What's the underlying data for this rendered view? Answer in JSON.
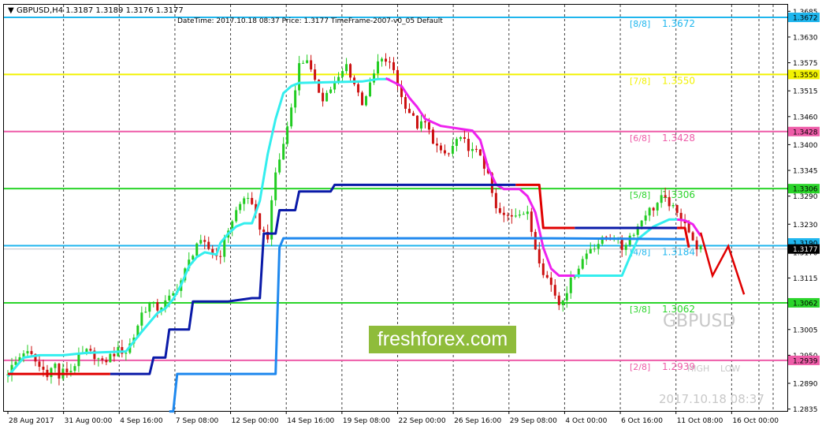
{
  "header": {
    "symbol_line": "GBPUSD,H4  1.3187 1.3189 1.3176 1.3177",
    "indicator_line": "DateTime: 2017.10.18 08:37    Price: 1.3177    TimeFrame-2007-v0_05    Default"
  },
  "watermark": {
    "brand": "freshforex.com",
    "symbol": "GBPUSD",
    "timestamp": "2017.10.18 08:37",
    "high_label": "HIGH",
    "low_label": "LOW"
  },
  "colors": {
    "bull": "#22cc22",
    "bear": "#cc1111",
    "cyan": "#33eeee",
    "magenta": "#ee22ee",
    "navy": "#0a1aa8",
    "blue": "#1e88ee",
    "red": "#e00000",
    "level_cyan": "#1fb6ee",
    "level_yellow": "#f2f200",
    "level_pink": "#ee5ca8",
    "level_green": "#2ad42a"
  },
  "chart_data": {
    "type": "candlestick",
    "title": "GBPUSD,H4",
    "ylim": [
      1.2831,
      1.3699
    ],
    "x_tick_labels": [
      "28 Aug 2017",
      "31 Aug 00:00",
      "4 Sep 16:00",
      "7 Sep 08:00",
      "12 Sep 00:00",
      "14 Sep 16:00",
      "19 Sep 08:00",
      "22 Sep 00:00",
      "26 Sep 16:00",
      "29 Sep 08:00",
      "4 Oct 00:00",
      "6 Oct 16:00",
      "11 Oct 08:00",
      "16 Oct 00:00"
    ],
    "y_tick_labels": [
      1.3685,
      1.363,
      1.3575,
      1.3515,
      1.346,
      1.34,
      1.3345,
      1.329,
      1.323,
      1.317,
      1.3115,
      1.306,
      1.3005,
      1.295,
      1.289,
      1.2835
    ],
    "current_price": 1.3177,
    "murrey_levels": [
      {
        "label": "[8/8]",
        "value": 1.3672,
        "tag": "1.3672",
        "color": "#1fb6ee"
      },
      {
        "label": "[7/8]",
        "value": 1.355,
        "tag": "1.3550",
        "color": "#f2f200"
      },
      {
        "label": "[6/8]",
        "value": 1.3428,
        "tag": "1.3428",
        "color": "#ee5ca8"
      },
      {
        "label": "[5/8]",
        "value": 1.3306,
        "tag": "1.3306",
        "color": "#2ad42a"
      },
      {
        "label": "[4/8]",
        "value": 1.3184,
        "tag": "1.3190",
        "color": "#1fb6ee"
      },
      {
        "label": "[3/8]",
        "value": 1.3062,
        "tag": "1.3062",
        "color": "#2ad42a"
      },
      {
        "label": "[2/8]",
        "value": 1.2939,
        "tag": "1.2939",
        "color": "#ee5ca8"
      }
    ],
    "close_series": [
      {
        "x": 0,
        "y": 1.2915
      },
      {
        "x": 2,
        "y": 1.2935
      },
      {
        "x": 4,
        "y": 1.2958
      },
      {
        "x": 6,
        "y": 1.2948
      },
      {
        "x": 8,
        "y": 1.2925
      },
      {
        "x": 10,
        "y": 1.2912
      },
      {
        "x": 12,
        "y": 1.293
      },
      {
        "x": 13,
        "y": 1.2902
      },
      {
        "x": 14,
        "y": 1.2915
      },
      {
        "x": 16,
        "y": 1.2918
      },
      {
        "x": 18,
        "y": 1.2945
      },
      {
        "x": 20,
        "y": 1.2957
      },
      {
        "x": 22,
        "y": 1.295
      },
      {
        "x": 24,
        "y": 1.2932
      },
      {
        "x": 26,
        "y": 1.2948
      },
      {
        "x": 28,
        "y": 1.296
      },
      {
        "x": 30,
        "y": 1.2958
      },
      {
        "x": 32,
        "y": 1.299
      },
      {
        "x": 34,
        "y": 1.304
      },
      {
        "x": 36,
        "y": 1.306
      },
      {
        "x": 38,
        "y": 1.305
      },
      {
        "x": 40,
        "y": 1.3062
      },
      {
        "x": 42,
        "y": 1.308
      },
      {
        "x": 44,
        "y": 1.311
      },
      {
        "x": 46,
        "y": 1.315
      },
      {
        "x": 48,
        "y": 1.319
      },
      {
        "x": 50,
        "y": 1.3185
      },
      {
        "x": 52,
        "y": 1.317
      },
      {
        "x": 53,
        "y": 1.3162
      },
      {
        "x": 54,
        "y": 1.3168
      },
      {
        "x": 56,
        "y": 1.322
      },
      {
        "x": 58,
        "y": 1.3258
      },
      {
        "x": 60,
        "y": 1.3285
      },
      {
        "x": 61,
        "y": 1.329
      },
      {
        "x": 62,
        "y": 1.3265
      },
      {
        "x": 64,
        "y": 1.3225
      },
      {
        "x": 65,
        "y": 1.321
      },
      {
        "x": 66,
        "y": 1.3205
      },
      {
        "x": 68,
        "y": 1.334
      },
      {
        "x": 70,
        "y": 1.34
      },
      {
        "x": 72,
        "y": 1.348
      },
      {
        "x": 74,
        "y": 1.357
      },
      {
        "x": 76,
        "y": 1.3585
      },
      {
        "x": 77,
        "y": 1.3555
      },
      {
        "x": 78,
        "y": 1.353
      },
      {
        "x": 80,
        "y": 1.35
      },
      {
        "x": 82,
        "y": 1.352
      },
      {
        "x": 84,
        "y": 1.354
      },
      {
        "x": 86,
        "y": 1.357
      },
      {
        "x": 88,
        "y": 1.353
      },
      {
        "x": 90,
        "y": 1.349
      },
      {
        "x": 92,
        "y": 1.3525
      },
      {
        "x": 94,
        "y": 1.3575
      },
      {
        "x": 96,
        "y": 1.358
      },
      {
        "x": 98,
        "y": 1.356
      },
      {
        "x": 100,
        "y": 1.35
      },
      {
        "x": 102,
        "y": 1.347
      },
      {
        "x": 104,
        "y": 1.344
      },
      {
        "x": 106,
        "y": 1.3445
      },
      {
        "x": 108,
        "y": 1.341
      },
      {
        "x": 110,
        "y": 1.338
      },
      {
        "x": 112,
        "y": 1.338
      },
      {
        "x": 114,
        "y": 1.341
      },
      {
        "x": 116,
        "y": 1.3405
      },
      {
        "x": 118,
        "y": 1.3385
      },
      {
        "x": 120,
        "y": 1.338
      },
      {
        "x": 122,
        "y": 1.333
      },
      {
        "x": 124,
        "y": 1.326
      },
      {
        "x": 126,
        "y": 1.3245
      },
      {
        "x": 128,
        "y": 1.325
      },
      {
        "x": 130,
        "y": 1.3258
      },
      {
        "x": 132,
        "y": 1.325
      },
      {
        "x": 134,
        "y": 1.318
      },
      {
        "x": 136,
        "y": 1.313
      },
      {
        "x": 138,
        "y": 1.31
      },
      {
        "x": 140,
        "y": 1.306
      },
      {
        "x": 142,
        "y": 1.309
      },
      {
        "x": 144,
        "y": 1.3125
      },
      {
        "x": 146,
        "y": 1.3155
      },
      {
        "x": 148,
        "y": 1.318
      },
      {
        "x": 150,
        "y": 1.319
      },
      {
        "x": 152,
        "y": 1.32
      },
      {
        "x": 154,
        "y": 1.3205
      },
      {
        "x": 156,
        "y": 1.3178
      },
      {
        "x": 158,
        "y": 1.3205
      },
      {
        "x": 160,
        "y": 1.3225
      },
      {
        "x": 162,
        "y": 1.3255
      },
      {
        "x": 164,
        "y": 1.3265
      },
      {
        "x": 166,
        "y": 1.3285
      },
      {
        "x": 168,
        "y": 1.3275
      },
      {
        "x": 170,
        "y": 1.325
      },
      {
        "x": 172,
        "y": 1.3238
      },
      {
        "x": 174,
        "y": 1.319
      },
      {
        "x": 176,
        "y": 1.3177
      }
    ],
    "indicator_lines": [
      {
        "color": "#33eeee",
        "points": [
          {
            "x": 0,
            "y": 1.2905
          },
          {
            "x": 4,
            "y": 1.2945
          },
          {
            "x": 8,
            "y": 1.295
          },
          {
            "x": 14,
            "y": 1.295
          },
          {
            "x": 20,
            "y": 1.2955
          },
          {
            "x": 30,
            "y": 1.2958
          },
          {
            "x": 34,
            "y": 1.3
          },
          {
            "x": 38,
            "y": 1.304
          },
          {
            "x": 40,
            "y": 1.305
          },
          {
            "x": 42,
            "y": 1.307
          },
          {
            "x": 44,
            "y": 1.31
          },
          {
            "x": 46,
            "y": 1.314
          },
          {
            "x": 48,
            "y": 1.316
          },
          {
            "x": 50,
            "y": 1.317
          },
          {
            "x": 53,
            "y": 1.3165
          },
          {
            "x": 54,
            "y": 1.319
          },
          {
            "x": 56,
            "y": 1.321
          },
          {
            "x": 58,
            "y": 1.3225
          },
          {
            "x": 60,
            "y": 1.3232
          },
          {
            "x": 62,
            "y": 1.3232
          },
          {
            "x": 64,
            "y": 1.328
          },
          {
            "x": 66,
            "y": 1.338
          },
          {
            "x": 68,
            "y": 1.3455
          },
          {
            "x": 70,
            "y": 1.351
          },
          {
            "x": 72,
            "y": 1.3525
          },
          {
            "x": 74,
            "y": 1.3532
          },
          {
            "x": 90,
            "y": 1.3535
          },
          {
            "x": 94,
            "y": 1.354
          },
          {
            "x": 97,
            "y": 1.354
          }
        ]
      },
      {
        "color": "#ee22ee",
        "points": [
          {
            "x": 96,
            "y": 1.3542
          },
          {
            "x": 100,
            "y": 1.3525
          },
          {
            "x": 102,
            "y": 1.35
          },
          {
            "x": 104,
            "y": 1.348
          },
          {
            "x": 106,
            "y": 1.3455
          },
          {
            "x": 110,
            "y": 1.344
          },
          {
            "x": 118,
            "y": 1.343
          },
          {
            "x": 120,
            "y": 1.341
          },
          {
            "x": 122,
            "y": 1.335
          },
          {
            "x": 124,
            "y": 1.3315
          },
          {
            "x": 126,
            "y": 1.3305
          },
          {
            "x": 130,
            "y": 1.3305
          },
          {
            "x": 132,
            "y": 1.329
          },
          {
            "x": 134,
            "y": 1.3255
          },
          {
            "x": 136,
            "y": 1.318
          },
          {
            "x": 138,
            "y": 1.3135
          },
          {
            "x": 140,
            "y": 1.312
          },
          {
            "x": 144,
            "y": 1.312
          }
        ]
      },
      {
        "color": "#33eeee",
        "points": [
          {
            "x": 144,
            "y": 1.312
          },
          {
            "x": 156,
            "y": 1.312
          },
          {
            "x": 158,
            "y": 1.316
          },
          {
            "x": 160,
            "y": 1.3198
          },
          {
            "x": 164,
            "y": 1.3225
          },
          {
            "x": 168,
            "y": 1.324
          },
          {
            "x": 170,
            "y": 1.324
          }
        ]
      },
      {
        "color": "#ee22ee",
        "points": [
          {
            "x": 170,
            "y": 1.324
          },
          {
            "x": 172,
            "y": 1.3238
          },
          {
            "x": 174,
            "y": 1.323
          },
          {
            "x": 176,
            "y": 1.3205
          }
        ]
      },
      {
        "color": "#e00000",
        "points": [
          {
            "x": 0,
            "y": 1.291
          },
          {
            "x": 26,
            "y": 1.291
          }
        ]
      },
      {
        "color": "#0a1aa8",
        "points": [
          {
            "x": 26,
            "y": 1.291
          },
          {
            "x": 36,
            "y": 1.291
          },
          {
            "x": 37,
            "y": 1.2945
          },
          {
            "x": 40,
            "y": 1.2945
          },
          {
            "x": 41,
            "y": 1.3005
          },
          {
            "x": 46,
            "y": 1.3005
          },
          {
            "x": 47,
            "y": 1.3065
          },
          {
            "x": 56,
            "y": 1.3065
          },
          {
            "x": 62,
            "y": 1.3072
          },
          {
            "x": 64,
            "y": 1.3072
          },
          {
            "x": 65,
            "y": 1.321
          },
          {
            "x": 68,
            "y": 1.321
          },
          {
            "x": 69,
            "y": 1.326
          },
          {
            "x": 73,
            "y": 1.326
          },
          {
            "x": 74,
            "y": 1.33
          },
          {
            "x": 82,
            "y": 1.33
          },
          {
            "x": 83,
            "y": 1.3314
          },
          {
            "x": 129,
            "y": 1.3314
          }
        ]
      },
      {
        "color": "#e00000",
        "points": [
          {
            "x": 129,
            "y": 1.3314
          },
          {
            "x": 135,
            "y": 1.3314
          },
          {
            "x": 136,
            "y": 1.3222
          },
          {
            "x": 144,
            "y": 1.3222
          }
        ]
      },
      {
        "color": "#0a1aa8",
        "points": [
          {
            "x": 144,
            "y": 1.3222
          },
          {
            "x": 170,
            "y": 1.3222
          }
        ]
      },
      {
        "color": "#e00000",
        "points": [
          {
            "x": 170,
            "y": 1.3222
          },
          {
            "x": 172,
            "y": 1.3222
          },
          {
            "x": 173,
            "y": 1.318
          }
        ]
      },
      {
        "color": "#1e88ee",
        "points": [
          {
            "x": 41,
            "y": 1.283
          },
          {
            "x": 42,
            "y": 1.283
          },
          {
            "x": 43,
            "y": 1.291
          },
          {
            "x": 68,
            "y": 1.291
          },
          {
            "x": 69,
            "y": 1.318
          },
          {
            "x": 70,
            "y": 1.32
          },
          {
            "x": 138,
            "y": 1.32
          },
          {
            "x": 172,
            "y": 1.3198
          }
        ]
      }
    ],
    "forecast_path": [
      {
        "x": 176,
        "y": 1.3212
      },
      {
        "x": 179,
        "y": 1.312
      },
      {
        "x": 183,
        "y": 1.3183
      },
      {
        "x": 187,
        "y": 1.308
      }
    ],
    "x_range": [
      -1,
      198
    ]
  }
}
